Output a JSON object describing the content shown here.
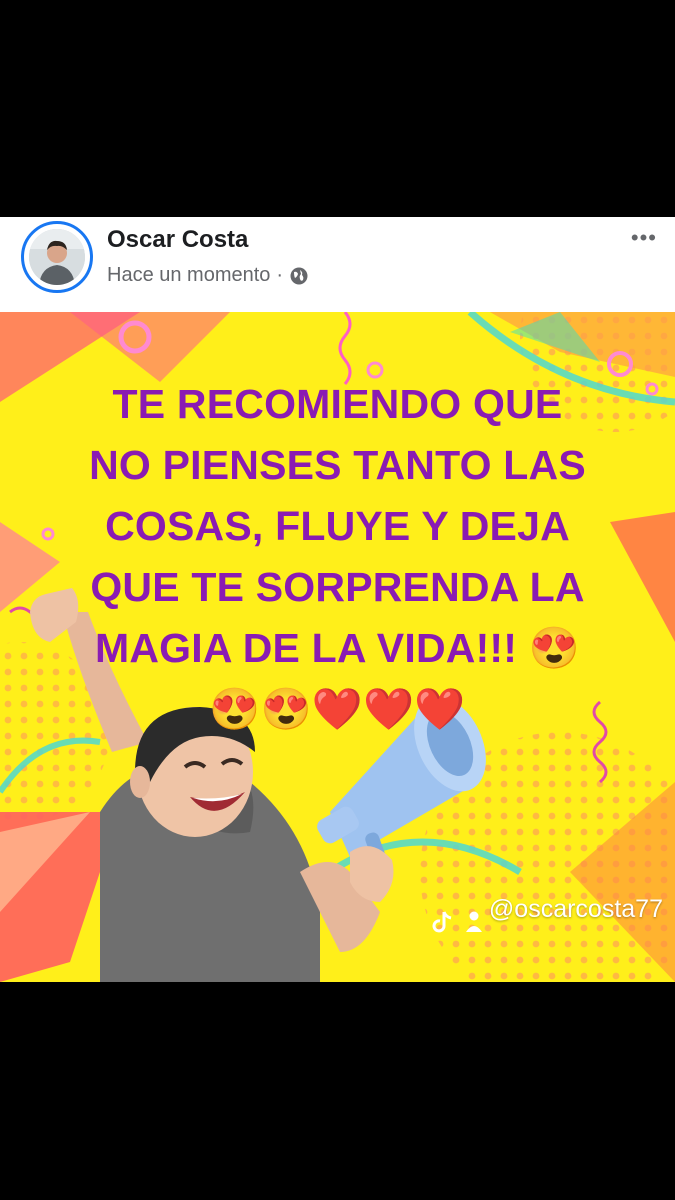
{
  "post": {
    "author": "Oscar Costa",
    "time": "Hace un momento",
    "separator": "·",
    "more_label": "•••",
    "headline_lines": [
      "TE RECOMIENDO QUE",
      "NO PIENSES TANTO LAS",
      "COSAS, FLUYE Y DEJA",
      "QUE TE SORPRENDA LA",
      "MAGIA DE LA VIDA!!! 😍",
      "😍😍❤️❤️❤️"
    ],
    "handle": "@oscarcosta77",
    "icons": [
      "globe-icon",
      "tiktok-icon",
      "person-icon",
      "more-options-icon",
      "megaphone-icon"
    ]
  },
  "colors": {
    "background": "#000000",
    "card": "#ffffff",
    "avatar_ring": "#1877f2",
    "headline": "#8a1bb3",
    "image_bg": "#ffef1a",
    "muted_text": "#65676b"
  }
}
